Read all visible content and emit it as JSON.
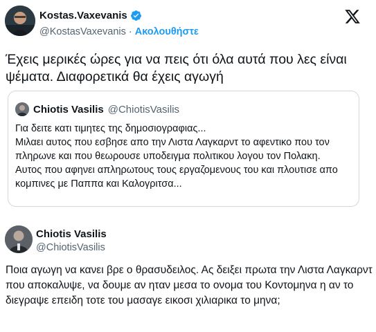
{
  "tweet": {
    "author_name": "Kostas.Vaxevanis",
    "handle": "@KostasVaxevanis",
    "separator": "·",
    "follow_label": "Ακολουθήστε",
    "text": "Έχεις μερικές ώρες για να πεις ότι όλα αυτά που λες είναι ψέματα. Διαφορετικά θα έχεις αγωγή",
    "icons": {
      "verified": "verified-badge-icon",
      "platform": "x-logo-icon"
    },
    "colors": {
      "accent": "#1d9bf0",
      "muted": "#536471",
      "border": "#cfd9de"
    }
  },
  "quote": {
    "author_name": "Chiotis Vasilis",
    "handle": "@ChiotisVasilis",
    "lines": [
      "Για δειτε κατι τιμητες της δημοσιογραφιας...",
      "Μιλαει αυτος που εσβησε απο την Λιστα Λαγκαρντ το αφεντικο που τον πληρωνε και που θεωρουσε υποδειγμα πολιτικου λογου τον Πολακη.",
      "Αυτος που αφηνει απληρωτους τους εργαζομενους του και πλουτισε απο κομπινες με Παππα και Καλογριτσα..."
    ]
  },
  "reply": {
    "author_name": "Chiotis Vasilis",
    "handle": "@ChiotisVasilis",
    "text": "Ποια αγωγη να κανει βρε ο θρασυδειλος. Ας δειξει πρωτα την Λιστα Λαγκαρντ που αποκαλυψε, να δουμε αν ηταν μεσα το ονομα του Κοντομηνα η αν το διεγραψε επειδη τοτε του μασαγε εικοσι χιλιαρικα το μηνα;"
  }
}
